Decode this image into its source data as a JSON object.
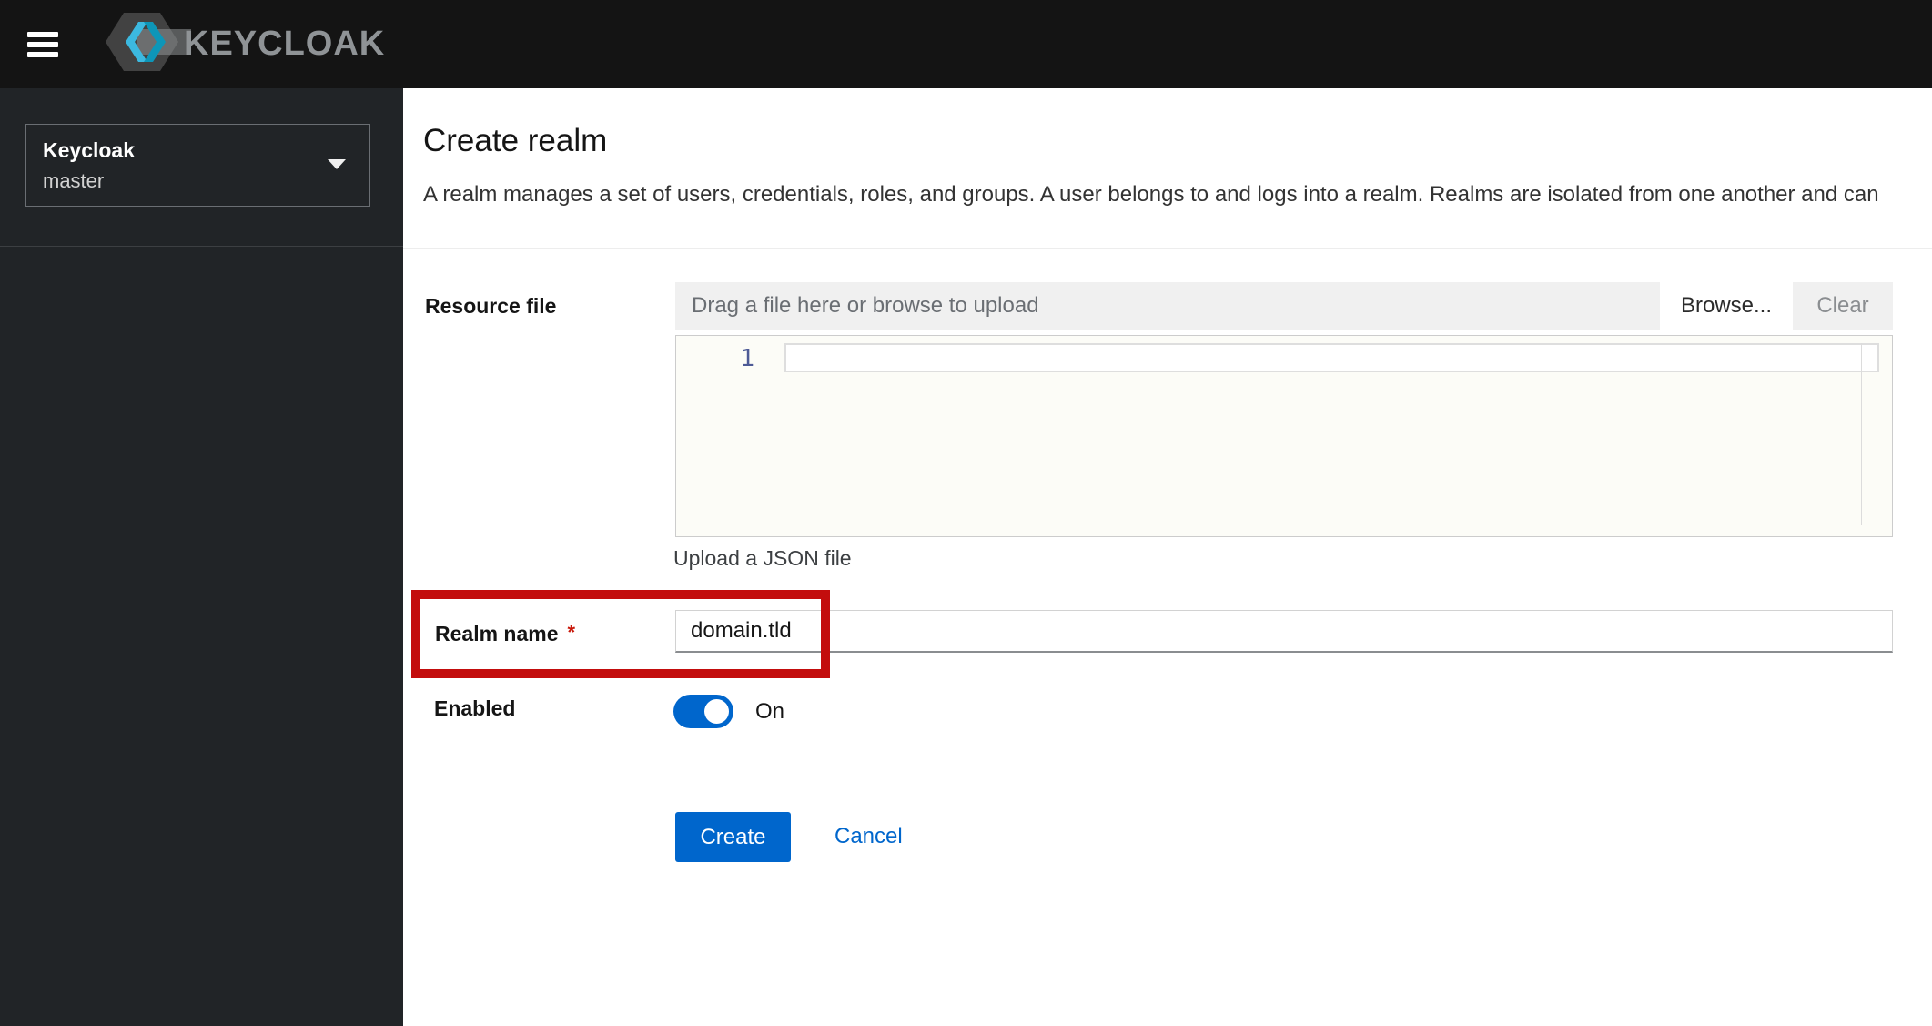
{
  "header": {
    "brand": "KEYCLOAK"
  },
  "sidebar": {
    "realm_switcher": {
      "realm_title": "Keycloak",
      "realm_current": "master"
    }
  },
  "page": {
    "title": "Create realm",
    "description": "A realm manages a set of users, credentials, roles, and groups. A user belongs to and logs into a realm. Realms are isolated from one another and can"
  },
  "form": {
    "resource_file": {
      "label": "Resource file",
      "placeholder": "Drag a file here or browse to upload",
      "browse_label": "Browse...",
      "clear_label": "Clear",
      "editor_line_number": "1",
      "helper_text": "Upload a JSON file"
    },
    "realm_name": {
      "label": "Realm name",
      "required_indicator": "*",
      "value": "domain.tld"
    },
    "enabled": {
      "label": "Enabled",
      "state_label": "On",
      "checked": true
    },
    "actions": {
      "create_label": "Create",
      "cancel_label": "Cancel"
    }
  },
  "colors": {
    "accent_blue": "#0066cc",
    "annotation_red": "#c30d0d",
    "header_background": "#141414",
    "sidebar_background": "#212427",
    "upload_field_background": "#f0f0f0",
    "logo_cyan_light": "#3cb9e0",
    "logo_cyan_dark": "#0d96b8"
  }
}
